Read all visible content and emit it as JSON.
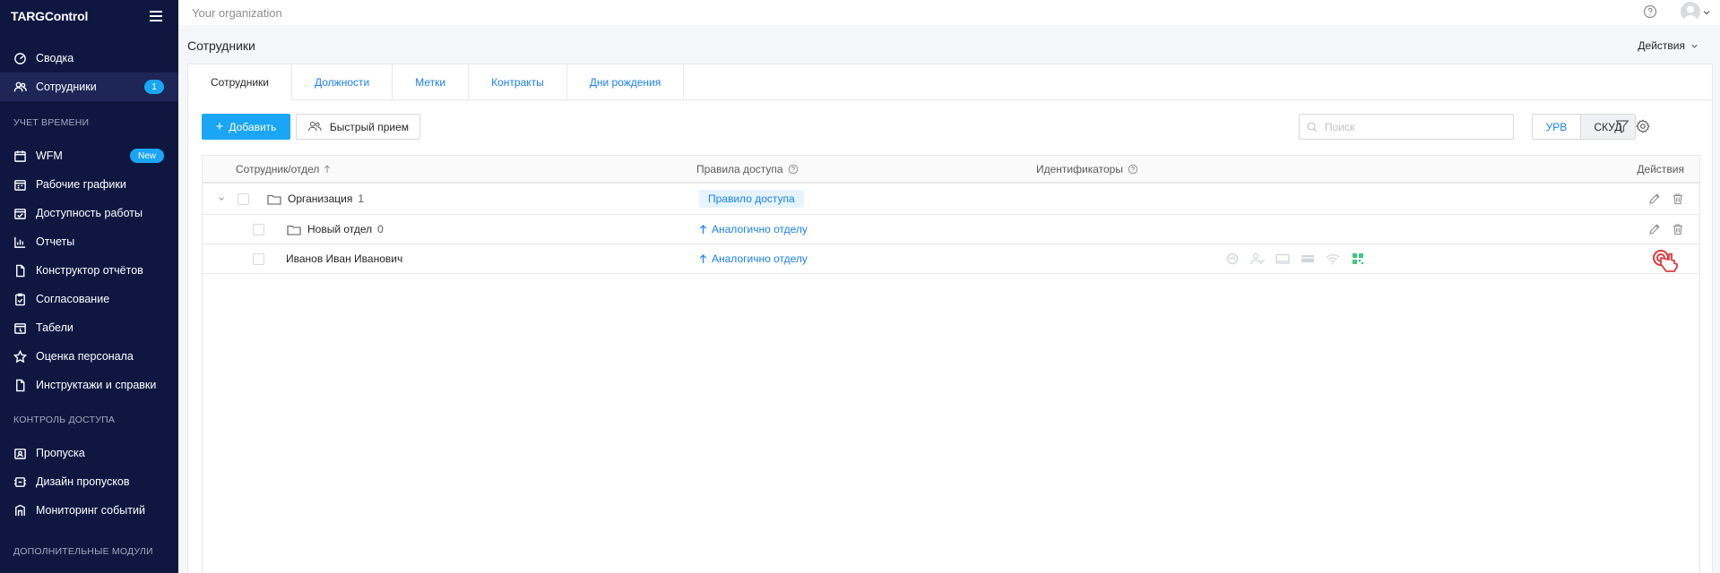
{
  "app": {
    "brand": "TARGControl"
  },
  "sidebar": {
    "items_top": [
      {
        "label": "Сводка",
        "icon": "dashboard-icon"
      },
      {
        "label": "Сотрудники",
        "icon": "users-icon",
        "badge": "1",
        "active": true
      }
    ],
    "section_time": "Учет времени",
    "items_time": [
      {
        "label": "WFM",
        "icon": "calendar-icon",
        "badge_new": "New"
      },
      {
        "label": "Рабочие графики",
        "icon": "schedule-icon"
      },
      {
        "label": "Доступность работы",
        "icon": "availability-icon"
      },
      {
        "label": "Отчеты",
        "icon": "reports-icon"
      },
      {
        "label": "Конструктор отчётов",
        "icon": "report-builder-icon"
      },
      {
        "label": "Согласование",
        "icon": "approval-icon"
      },
      {
        "label": "Табели",
        "icon": "timesheet-icon"
      },
      {
        "label": "Оценка персонала",
        "icon": "star-icon"
      },
      {
        "label": "Инструктажи и справки",
        "icon": "document-icon"
      }
    ],
    "section_access": "Контроль доступа",
    "items_access": [
      {
        "label": "Пропуска",
        "icon": "pass-icon"
      },
      {
        "label": "Дизайн пропусков",
        "icon": "pass-design-icon"
      },
      {
        "label": "Мониторинг событий",
        "icon": "monitoring-icon"
      }
    ],
    "section_modules": "Дополнительные модули"
  },
  "topbar": {
    "org": "Your organization"
  },
  "page": {
    "title": "Сотрудники",
    "actions": "Действия"
  },
  "tabs": [
    "Сотрудники",
    "Должности",
    "Метки",
    "Контракты",
    "Дни рождения"
  ],
  "toolbar": {
    "add": "Добавить",
    "quick": "Быстрый прием",
    "search_placeholder": "Поиск",
    "seg_a": "УРВ",
    "seg_b": "СКУД"
  },
  "table": {
    "headers": {
      "employee": "Сотрудник/отдел",
      "rules": "Правила доступа",
      "identifiers": "Идентификаторы",
      "actions": "Действия"
    },
    "rows": [
      {
        "name": "Организация",
        "count": "1",
        "rule": "Правило доступа"
      },
      {
        "name": "Новый отдел",
        "count": "0",
        "rule": "Аналогично отделу"
      },
      {
        "name": "Иванов Иван Иванович",
        "rule": "Аналогично отделу"
      }
    ]
  },
  "colors": {
    "sidebar_bg": "#0f1741",
    "accent": "#1aa6f5",
    "link": "#1a7ff5"
  }
}
